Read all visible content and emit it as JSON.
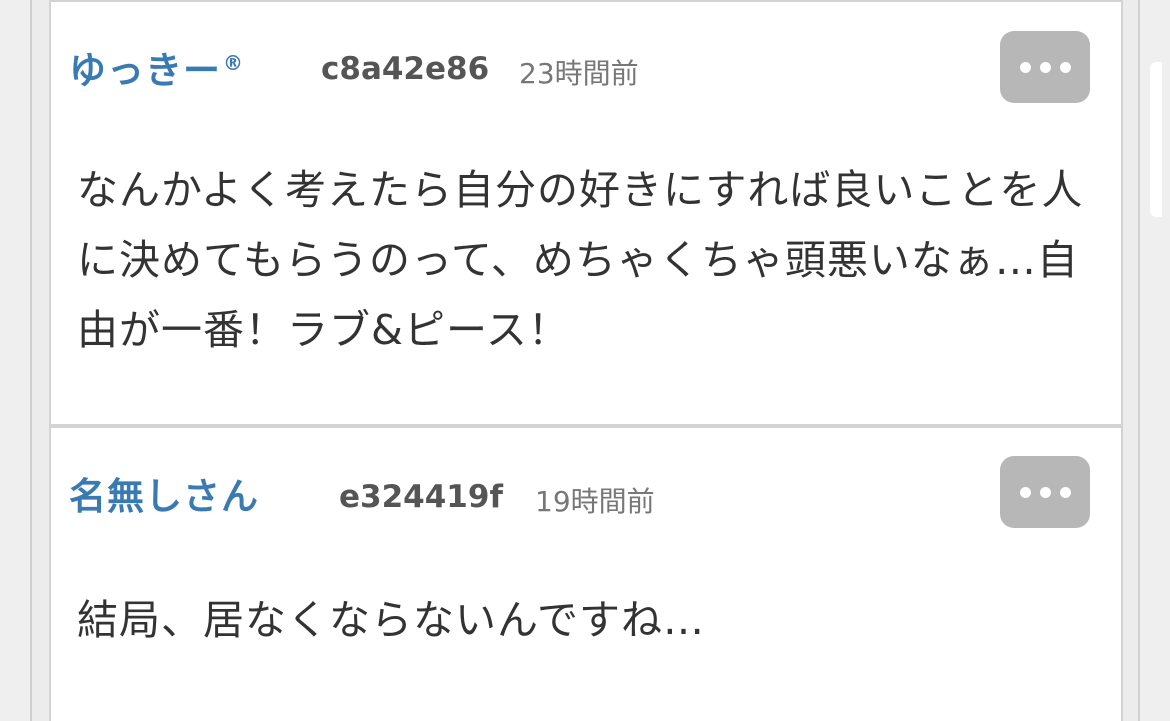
{
  "comments": [
    {
      "author": "ゆっきー",
      "author_mark": "®",
      "user_id": "c8a42e86",
      "time": "23時間前",
      "body": "なんかよく考えたら自分の好きにすれば良いことを人に決めてもらうのって、めちゃくちゃ頭悪いなぁ…自由が一番！ラブ&ピース！",
      "menu_icon": "ellipsis-icon"
    },
    {
      "author": "名無しさん",
      "user_id": "e324419f",
      "time": "19時間前",
      "body": "結局、居なくならないんですね…",
      "menu_icon": "ellipsis-icon"
    }
  ],
  "colors": {
    "author": "#3a7ab3",
    "menu_button": "#b7b7b7",
    "border": "#d3d3d3"
  }
}
